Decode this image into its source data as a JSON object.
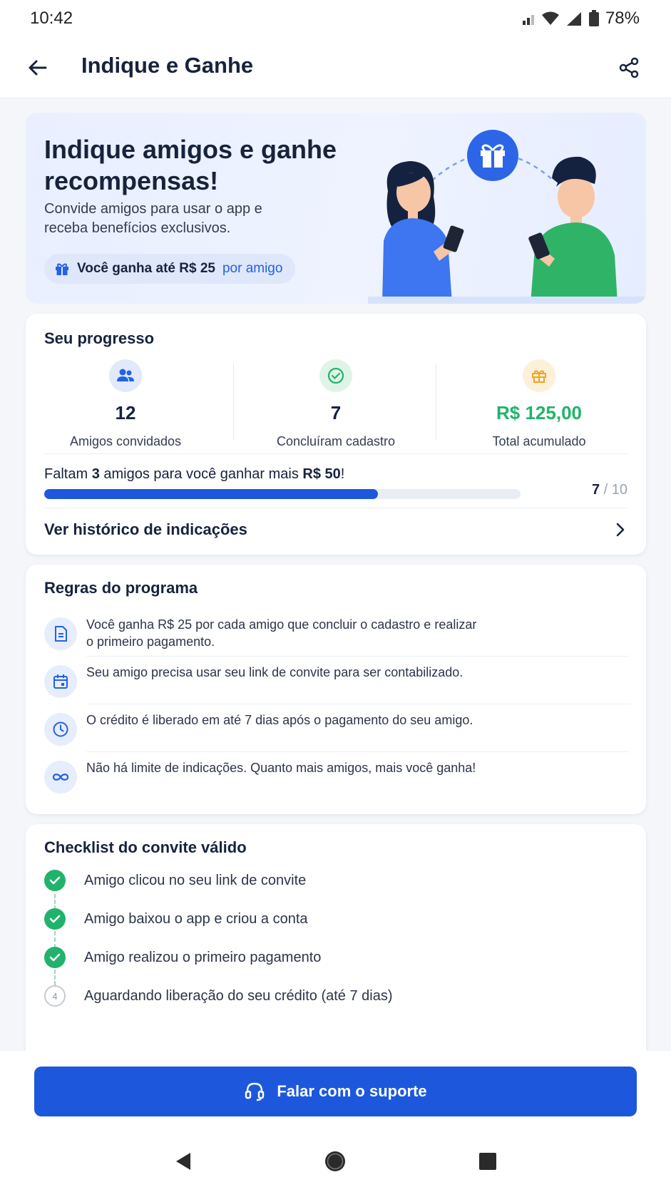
{
  "status": {
    "time": "10:42",
    "battery": "78%"
  },
  "appbar": {
    "title": "Indique e Ganhe"
  },
  "hero": {
    "title": "Indique amigos e ganhe recompensas!",
    "subtitle": "Convide amigos para usar o app e receba benefícios exclusivos.",
    "pill_main": "Você ganha até R$ 25",
    "pill_accent": "por amigo"
  },
  "progress": {
    "title": "Seu progresso",
    "stats": [
      {
        "value": "12",
        "label": "Amigos convidados"
      },
      {
        "value": "7",
        "label": "Concluíram cadastro"
      },
      {
        "value": "R$ 125,00",
        "label": "Total acumulado"
      }
    ],
    "message_pre": "Faltam ",
    "message_count": "3",
    "message_mid": " amigos para você ganhar mais ",
    "message_amount": "R$ 50",
    "message_post": "!",
    "current": "7",
    "separator": "/",
    "target": "10",
    "fraction": 0.7,
    "history_label": "Ver histórico de indicações"
  },
  "rules": {
    "title": "Regras do programa",
    "items": [
      {
        "icon": "document-icon",
        "text": "Você ganha R$ 25 por cada amigo que concluir o cadastro e realizar o primeiro pagamento."
      },
      {
        "icon": "calendar-icon",
        "text": "Seu amigo precisa usar seu link de convite para ser contabilizado."
      },
      {
        "icon": "clock-icon",
        "text": "O crédito é liberado em até 7 dias após o pagamento do seu amigo."
      },
      {
        "icon": "infinity-icon",
        "text": "Não há limite de indicações. Quanto mais amigos, mais você ganha!"
      }
    ]
  },
  "checklist": {
    "title": "Checklist do convite válido",
    "steps": [
      {
        "text": "Amigo clicou no seu link de convite",
        "done": true
      },
      {
        "text": "Amigo baixou o app e criou a conta",
        "done": true
      },
      {
        "text": "Amigo realizou o primeiro pagamento",
        "done": true
      },
      {
        "text": "Aguardando liberação do seu crédito (até 7 dias)",
        "done": false,
        "number": "4"
      }
    ]
  },
  "support": {
    "label": "Falar com o suporte"
  },
  "colors": {
    "primary": "#1d58dc",
    "success": "#21b36b",
    "accent_text": "#2461e4"
  }
}
